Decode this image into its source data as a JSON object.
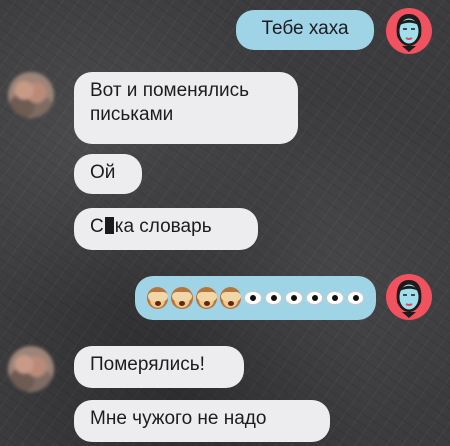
{
  "messages": [
    {
      "id": "m1",
      "side": "out",
      "text": "Тебе хаха"
    },
    {
      "id": "m2",
      "side": "in",
      "text": "Вот и поменялись\nписьками"
    },
    {
      "id": "m3",
      "side": "in",
      "text": "Ой"
    },
    {
      "id": "m4",
      "side": "in",
      "text_before": "С",
      "text_after": "ка словарь",
      "censored": true
    },
    {
      "id": "m5",
      "side": "out",
      "emoji": [
        "scream-monkey-icon",
        "scream-monkey-icon",
        "scream-monkey-icon",
        "scream-monkey-icon",
        "eyes-icon",
        "eyes-icon",
        "eyes-icon",
        "eyes-icon",
        "eyes-icon",
        "eyes-icon"
      ]
    },
    {
      "id": "m6",
      "side": "in",
      "text": "Померялись!"
    },
    {
      "id": "m7",
      "side": "in",
      "text": "Мне чужого не надо"
    }
  ],
  "colors": {
    "outgoing_bubble": "#9fd3e6",
    "incoming_bubble": "#ededf0",
    "my_avatar": "#f0525f",
    "background": "#3c3c3e"
  }
}
